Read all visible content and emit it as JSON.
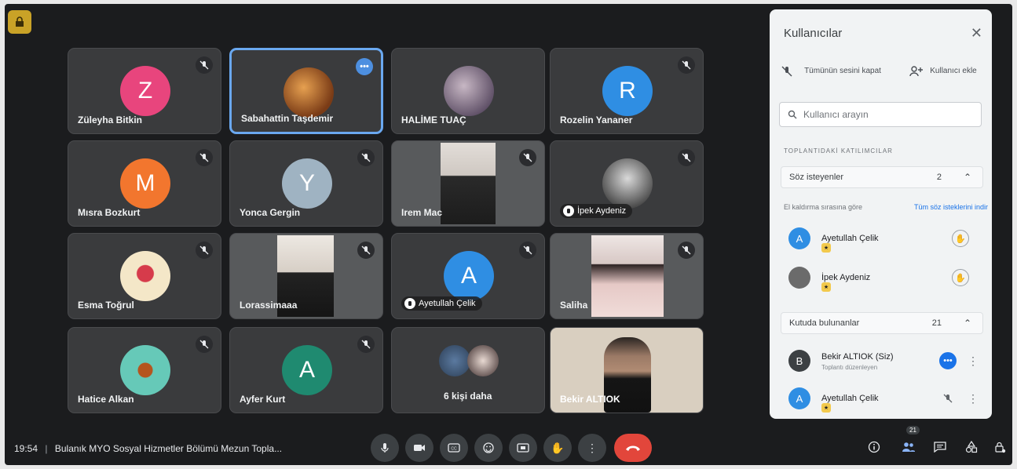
{
  "tiles": [
    {
      "name": "Züleyha Bitkin",
      "initial": "Z",
      "color": "#e8457d"
    },
    {
      "name": "Sabahattin Taşdemir",
      "initial": "",
      "color": "#a45a2a"
    },
    {
      "name": "HALİME TUAÇ",
      "initial": "",
      "color": "#9c8f9a"
    },
    {
      "name": "Rozelin Yananer",
      "initial": "R",
      "color": "#2f8ee3"
    },
    {
      "name": "Mısra Bozkurt",
      "initial": "M",
      "color": "#f2762e"
    },
    {
      "name": "Yonca Gergin",
      "initial": "Y",
      "color": "#9fb3c2"
    },
    {
      "name": "Irem Mac",
      "initial": "",
      "color": "#d9d3ce"
    },
    {
      "name": "İpek Aydeniz",
      "initial": "",
      "color": "#8c8c8c"
    },
    {
      "name": "Esma Toğrul",
      "initial": "",
      "color": "#f4e7c8"
    },
    {
      "name": "Lorassimaaa",
      "initial": "",
      "color": "#e9e3dc"
    },
    {
      "name": "Ayetullah Çelik",
      "initial": "A",
      "color": "#2f8ee3"
    },
    {
      "name": "Saliha",
      "initial": "",
      "color": "#efe6e6"
    },
    {
      "name": "Hatice Alkan",
      "initial": "",
      "color": "#66c9b8"
    },
    {
      "name": "Ayfer Kurt",
      "initial": "A",
      "color": "#1f8a70"
    },
    {
      "name": "6 kişi daha",
      "initial": "",
      "color": "#6d8aa8"
    },
    {
      "name": "Bekir ALTIOK",
      "initial": "",
      "color": "#d9cfc0"
    }
  ],
  "panel": {
    "title": "Kullanıcılar",
    "mute_all": "Tümünün sesini kapat",
    "add_user": "Kullanıcı ekle",
    "search_placeholder": "Kullanıcı arayın",
    "section_title": "TOPLANTIDAKİ KATILIMCILAR",
    "speakers_group": {
      "label": "Söz isteyenler",
      "count": "2"
    },
    "queue_label": "El kaldırma sırasına göre",
    "lower_all": "Tüm söz isteklerini indir",
    "speakers": [
      {
        "name": "Ayetullah Çelik",
        "initial": "A",
        "color": "#2f8ee3"
      },
      {
        "name": "İpek Aydeniz",
        "initial": "",
        "color": "#6b6b6b"
      }
    ],
    "in_call_group": {
      "label": "Kutuda bulunanlar",
      "count": "21"
    },
    "in_call": [
      {
        "name": "Bekir ALTIOK (Siz)",
        "sub": "Toplantı düzenleyen",
        "initial": "B",
        "color": "#3c4043"
      },
      {
        "name": "Ayetullah Çelik",
        "sub": "",
        "initial": "A",
        "color": "#2f8ee3"
      }
    ]
  },
  "bottom": {
    "time": "19:54",
    "meeting_title": "Bulanık MYO Sosyal Hizmetler Bölümü Mezun Topla...",
    "participants_badge": "21"
  }
}
